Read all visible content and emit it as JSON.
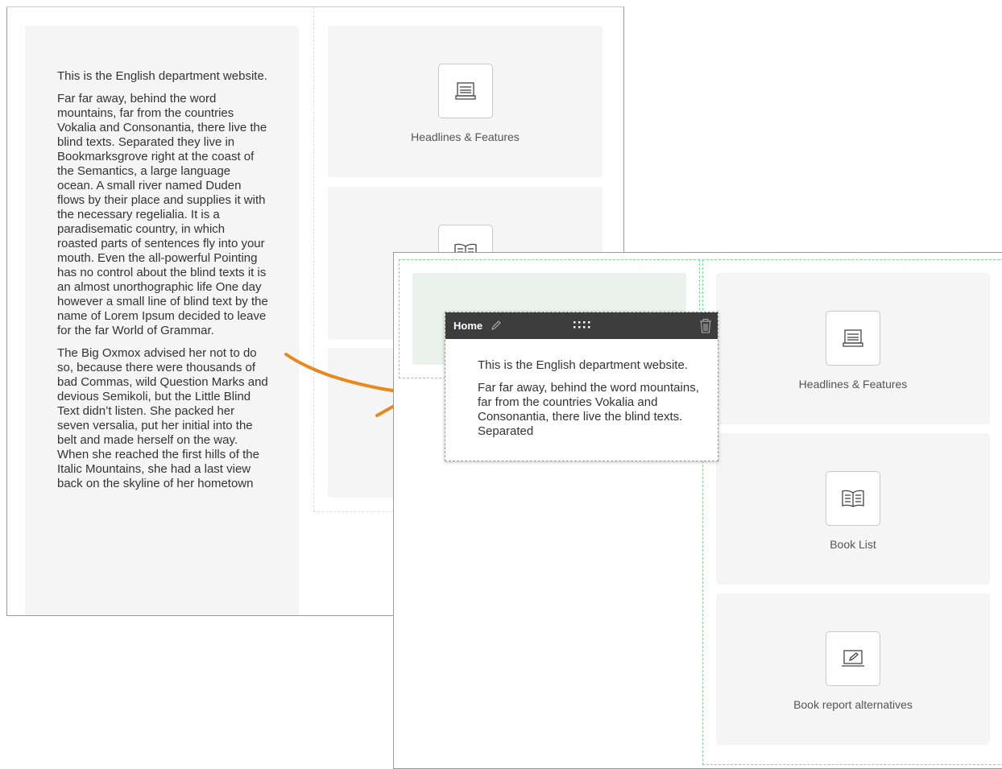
{
  "text_block": {
    "paragraphs": [
      "This is the English department website.",
      "Far far away, behind the word mountains, far from the countries Vokalia and Consonantia, there live the blind texts. Separated they live in Bookmarksgrove right at the coast of the Semantics, a large language ocean. A small river named Duden flows by their place and supplies it with the necessary regelialia. It is a paradisematic country, in which roasted parts of sentences fly into your mouth. Even the all-powerful Pointing has no control about the blind texts it is an almost unorthographic life One day however a small line of blind text by the name of Lorem Ipsum decided to leave for the far World of Grammar.",
      "The Big Oxmox advised her not to do so, because there were thousands of bad Commas, wild Question Marks and devious Semikoli, but the Little Blind Text didn’t listen. She packed her seven versalia, put her initial into the belt and made herself on the way. When she reached the first hills of the Italic Mountains, she had a last view back on the skyline of her hometown"
    ]
  },
  "tiles": [
    {
      "label": "Headlines & Features",
      "icon": "newspaper-icon"
    },
    {
      "label": "Book List",
      "icon": "open-book-icon"
    },
    {
      "label": "Book report alternatives",
      "icon": "edit-screen-icon"
    }
  ],
  "popup": {
    "title": "Home",
    "edit_icon": "pencil-icon",
    "drag_icon": "drag-handle-icon",
    "delete_icon": "trash-icon",
    "paragraphs": [
      "This is the English department website.",
      "Far far away, behind the word mountains, far from the countries Vokalia and Consonantia, there live the blind texts. Separated"
    ]
  },
  "colors": {
    "arrow": "#e8891e",
    "drop_zone": "#7fd89a",
    "popup_bar": "#3d3d3d",
    "tile_bg": "#f5f5f5"
  }
}
